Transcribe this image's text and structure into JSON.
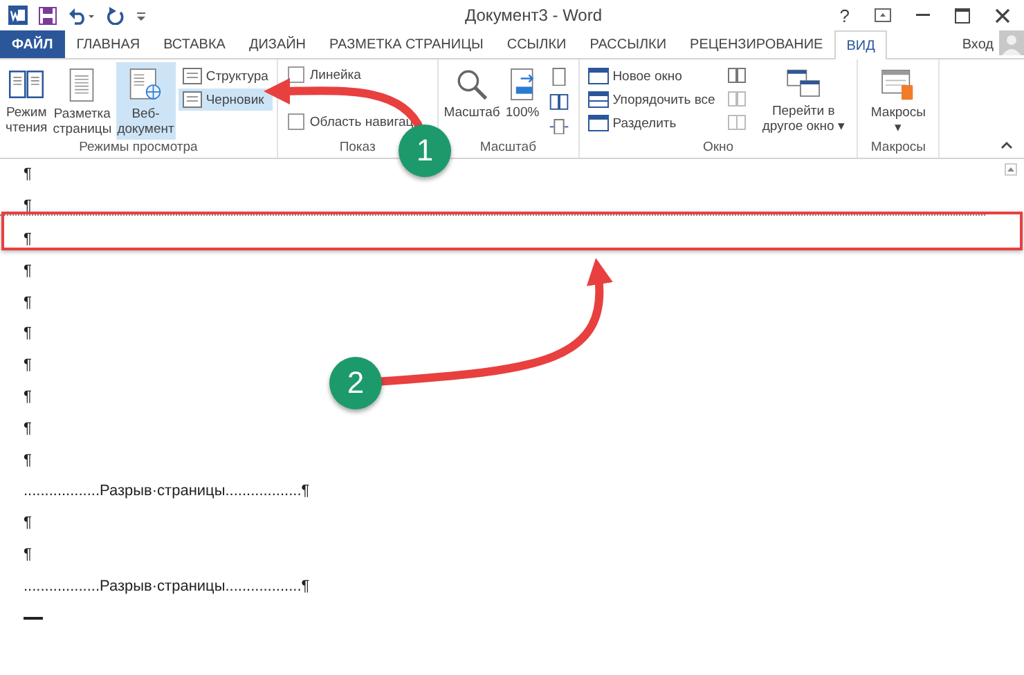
{
  "window": {
    "title": "Документ3 - Word",
    "help": "?"
  },
  "tabs": [
    {
      "label": "ФАЙЛ",
      "kind": "file",
      "selected": false
    },
    {
      "label": "ГЛАВНАЯ",
      "kind": "tab",
      "selected": false
    },
    {
      "label": "ВСТАВКА",
      "kind": "tab",
      "selected": false
    },
    {
      "label": "ДИЗАЙН",
      "kind": "tab",
      "selected": false
    },
    {
      "label": "РАЗМЕТКА СТРАНИЦЫ",
      "kind": "tab",
      "selected": false
    },
    {
      "label": "ССЫЛКИ",
      "kind": "tab",
      "selected": false
    },
    {
      "label": "РАССЫЛКИ",
      "kind": "tab",
      "selected": false
    },
    {
      "label": "РЕЦЕНЗИРОВАНИЕ",
      "kind": "tab",
      "selected": false
    },
    {
      "label": "ВИД",
      "kind": "tab",
      "selected": true
    }
  ],
  "account": {
    "sign_in": "Вход"
  },
  "ribbon": {
    "views": {
      "label": "Режимы просмотра",
      "large": [
        {
          "label": "Режим\nчтения",
          "selected": false
        },
        {
          "label": "Разметка\nстраницы",
          "selected": false
        },
        {
          "label": "Веб-\nдокумент",
          "selected": true
        }
      ],
      "small": [
        {
          "label": "Структура",
          "selected": false
        },
        {
          "label": "Черновик",
          "selected": true
        }
      ]
    },
    "show": {
      "label": "Показ",
      "checkboxes": [
        {
          "label": "Линейка",
          "checked": false
        },
        {
          "label": "Область навигац",
          "checked": false
        }
      ]
    },
    "zoom": {
      "label": "Масштаб",
      "buttons": [
        "Масштаб",
        "100%"
      ]
    },
    "window": {
      "label": "Окно",
      "commands": [
        "Новое окно",
        "Упорядочить все",
        "Разделить"
      ],
      "switch": "Перейти в\nдругое окно ▾"
    },
    "macros": {
      "label": "Макросы",
      "button": "Макросы\n▾"
    }
  },
  "document": {
    "lines": [
      {
        "kind": "para",
        "text": "¶"
      },
      {
        "kind": "para",
        "text": "¶"
      },
      {
        "kind": "section_break"
      },
      {
        "kind": "para",
        "text": "¶"
      },
      {
        "kind": "para",
        "text": "¶"
      },
      {
        "kind": "para",
        "text": "¶"
      },
      {
        "kind": "para",
        "text": "¶"
      },
      {
        "kind": "para",
        "text": "¶"
      },
      {
        "kind": "para",
        "text": "¶"
      },
      {
        "kind": "para",
        "text": "¶"
      },
      {
        "kind": "para",
        "text": "¶"
      },
      {
        "kind": "page_break",
        "text": "..................Разрыв·страницы..................¶"
      },
      {
        "kind": "para",
        "text": "¶"
      },
      {
        "kind": "para",
        "text": "¶"
      },
      {
        "kind": "page_break",
        "text": "..................Разрыв·страницы..................¶"
      },
      {
        "kind": "end"
      }
    ]
  },
  "callouts": [
    {
      "number": "1"
    },
    {
      "number": "2"
    }
  ]
}
